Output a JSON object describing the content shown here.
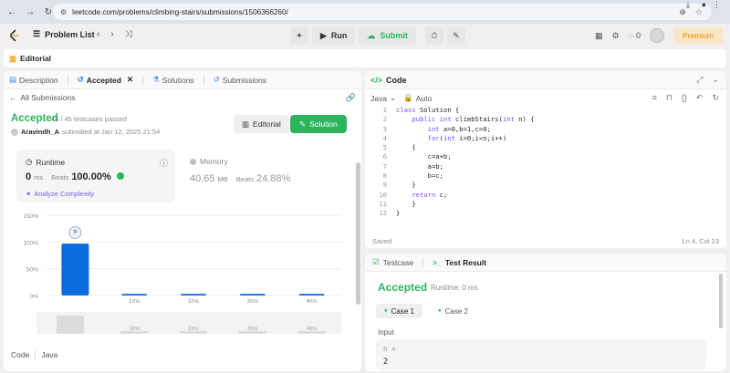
{
  "browser": {
    "url": "leetcode.com/problems/climbing-stairs/submissions/1506366260/"
  },
  "nav": {
    "problem_list": "Problem List",
    "run": "Run",
    "submit": "Submit",
    "streak_count": "0",
    "premium": "Premium"
  },
  "editorial_strip": {
    "label": "Editorial"
  },
  "left": {
    "tabs": [
      {
        "label": "Description"
      },
      {
        "label": "Accepted"
      },
      {
        "label": "Solutions"
      },
      {
        "label": "Submissions"
      }
    ],
    "back_label": "All Submissions",
    "status": "Accepted",
    "testcases": "45 / 45 testcases passed",
    "author": "Aravindh_A",
    "submitted_at": "submitted at Jan 12, 2025 21:54",
    "editorial_btn": "Editorial",
    "solution_btn": "Solution",
    "runtime": {
      "label": "Runtime",
      "value": "0",
      "unit": "ms",
      "beats_label": "Beats",
      "beats_value": "100.00%",
      "analyze": "Analyze Complexity"
    },
    "memory": {
      "label": "Memory",
      "value": "40.65",
      "unit": "MB",
      "beats_label": "Beats",
      "beats_value": "24.88%"
    },
    "code_label": "Code",
    "code_lang": "Java"
  },
  "chart_data": {
    "type": "bar",
    "categories": [
      "0ms",
      "1ms",
      "2ms",
      "3ms",
      "4ms"
    ],
    "values": [
      97,
      3,
      3,
      3,
      3
    ],
    "ylabel": "",
    "ylim": [
      0,
      150
    ],
    "yticks": [
      "0%",
      "50%",
      "100%",
      "150%"
    ],
    "highlight_category": "0ms",
    "bar_color": "#0a6cdf",
    "navigator_labels": [
      "1ms",
      "2ms",
      "3ms",
      "4ms"
    ]
  },
  "code": {
    "title": "Code",
    "language": "Java",
    "mode": "Auto",
    "lines": [
      "class Solution {",
      "    public int climbStairs(int n) {",
      "        int a=0,b=1,c=0;",
      "        for(int i=0;i<n;i++)",
      "    {",
      "        c=a+b;",
      "        a=b;",
      "        b=c;",
      "    }",
      "    return c;",
      "    }",
      "}"
    ],
    "saved": "Saved",
    "cursor": "Ln 4, Col 23"
  },
  "test": {
    "tab_testcase": "Testcase",
    "tab_result": "Test Result",
    "status": "Accepted",
    "runtime": "Runtime: 0 ms",
    "cases": [
      "Case 1",
      "Case 2"
    ],
    "input_label": "Input",
    "input_name": "n =",
    "input_value": "2"
  }
}
